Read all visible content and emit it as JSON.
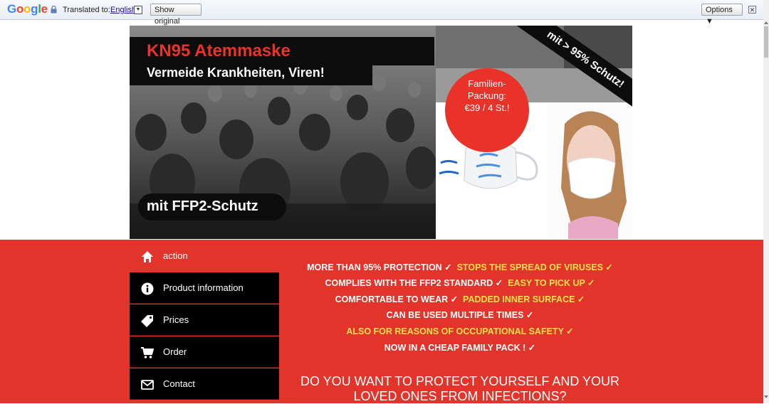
{
  "translate_bar": {
    "logo": "Google",
    "translated_to_label": "Translated to:",
    "language": "English",
    "language_arrow": "▼",
    "show_original_label": "Show original",
    "options_label": "Options ▼",
    "close_label": "✕"
  },
  "hero": {
    "headline": "KN95 Atemmaske",
    "subline": "Vermeide Krankheiten, Viren!",
    "ffp2_badge": "mit FFP2-Schutz",
    "ribbon": "mit > 95% Schutz!",
    "price_badge": {
      "line1": "Familien-",
      "line2": "Packung:",
      "line3": "€39 / 4 St.!"
    }
  },
  "menu": {
    "items": [
      {
        "label": "action",
        "icon": "home-icon"
      },
      {
        "label": "Product information",
        "icon": "info-icon"
      },
      {
        "label": "Prices",
        "icon": "tag-icon"
      },
      {
        "label": "Order",
        "icon": "cart-icon"
      },
      {
        "label": "Contact",
        "icon": "mail-icon"
      }
    ]
  },
  "features": {
    "l1a": "MORE THAN 95% PROTECTION ✓",
    "l1b": "STOPS THE SPREAD OF VIRUSES ✓",
    "l2a": "COMPLIES WITH THE FFP2 STANDARD ✓",
    "l2b": "EASY TO PICK UP ✓",
    "l3a": "COMFORTABLE TO WEAR ✓",
    "l3b": "PADDED INNER SURFACE ✓",
    "l4a": "CAN BE USED MULTIPLE TIMES ✓",
    "l5b": "ALSO FOR REASONS OF OCCUPATIONAL SAFETY ✓",
    "l6a": "NOW IN A CHEAP FAMILY PACK ! ✓"
  },
  "question": {
    "line1": "DO YOU WANT TO PROTECT YOURSELF AND YOUR",
    "line2": "LOVED ONES FROM INFECTIONS?"
  },
  "colors": {
    "accent_red": "#e3342b",
    "headline_red": "#e8322a",
    "highlight_yellow": "#ffe14d",
    "menu_black": "#000000"
  }
}
